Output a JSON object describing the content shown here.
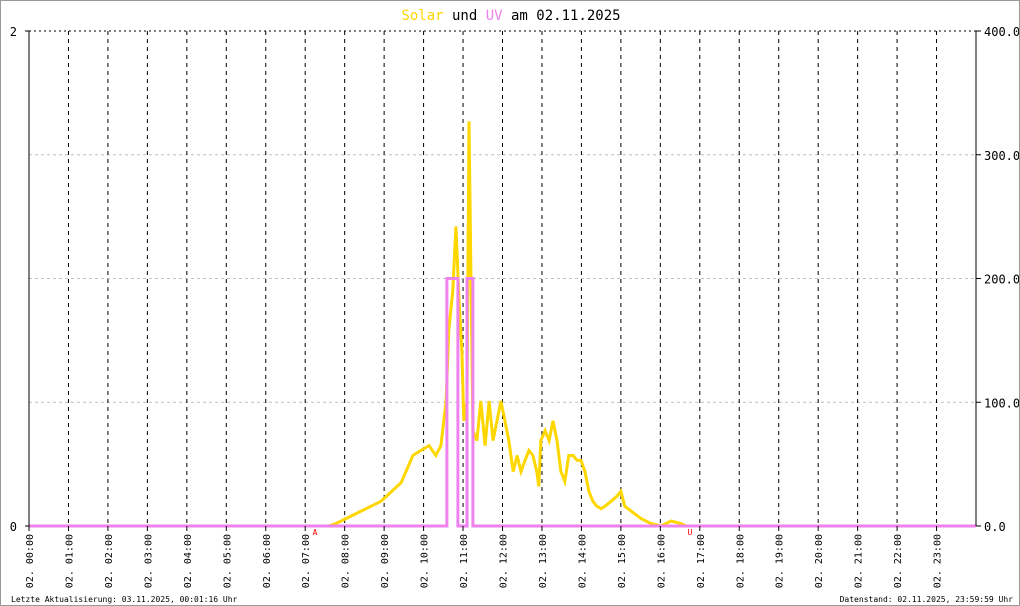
{
  "chart_data": {
    "type": "line",
    "title": {
      "part1": "Solar",
      "part2": " und ",
      "part3": "UV",
      "part4": " am 02.11.2025"
    },
    "x_unit": "hours",
    "xlim": [
      0,
      24
    ],
    "x_tick_labels": [
      "02. 00:00",
      "02. 01:00",
      "02. 02:00",
      "02. 03:00",
      "02. 04:00",
      "02. 05:00",
      "02. 06:00",
      "02. 07:00",
      "02. 08:00",
      "02. 09:00",
      "02. 10:00",
      "02. 11:00",
      "02. 12:00",
      "02. 13:00",
      "02. 14:00",
      "02. 15:00",
      "02. 16:00",
      "02. 17:00",
      "02. 18:00",
      "02. 19:00",
      "02. 20:00",
      "02. 21:00",
      "02. 22:00",
      "02. 23:00"
    ],
    "left_axis": {
      "label": "UV",
      "ylim": [
        0,
        2
      ],
      "tick_labels": [
        "0",
        "2"
      ]
    },
    "right_axis": {
      "label": "Solar",
      "ylim": [
        0,
        400
      ],
      "tick_labels": [
        "0.0",
        "100.0",
        "200.0",
        "300.0",
        "400.0"
      ]
    },
    "grid": true,
    "markers": [
      {
        "label": "A",
        "x": 7.25
      },
      {
        "label": "U",
        "x": 16.75
      }
    ],
    "series": [
      {
        "name": "Solar",
        "axis": "right",
        "color": "#FFD700",
        "points": [
          [
            0,
            0
          ],
          [
            7.6,
            0
          ],
          [
            7.78,
            2
          ],
          [
            8.16,
            8
          ],
          [
            8.92,
            20
          ],
          [
            9.43,
            35
          ],
          [
            9.73,
            57
          ],
          [
            9.93,
            61
          ],
          [
            10.14,
            65
          ],
          [
            10.31,
            57
          ],
          [
            10.44,
            65
          ],
          [
            10.57,
            101
          ],
          [
            10.64,
            158
          ],
          [
            10.74,
            190
          ],
          [
            10.82,
            242
          ],
          [
            10.9,
            182
          ],
          [
            10.97,
            141
          ],
          [
            11.02,
            85
          ],
          [
            11.1,
            101
          ],
          [
            11.15,
            327
          ],
          [
            11.2,
            206
          ],
          [
            11.25,
            77
          ],
          [
            11.35,
            69
          ],
          [
            11.45,
            101
          ],
          [
            11.56,
            65
          ],
          [
            11.66,
            101
          ],
          [
            11.76,
            69
          ],
          [
            11.86,
            85
          ],
          [
            11.96,
            101
          ],
          [
            12.06,
            85
          ],
          [
            12.16,
            69
          ],
          [
            12.27,
            44
          ],
          [
            12.37,
            57
          ],
          [
            12.47,
            44
          ],
          [
            12.57,
            53
          ],
          [
            12.67,
            61
          ],
          [
            12.77,
            57
          ],
          [
            12.87,
            44
          ],
          [
            12.92,
            32
          ],
          [
            12.97,
            69
          ],
          [
            13.08,
            77
          ],
          [
            13.18,
            69
          ],
          [
            13.28,
            85
          ],
          [
            13.38,
            69
          ],
          [
            13.48,
            44
          ],
          [
            13.58,
            36
          ],
          [
            13.68,
            57
          ],
          [
            13.79,
            57
          ],
          [
            13.89,
            53
          ],
          [
            13.99,
            53
          ],
          [
            14.09,
            44
          ],
          [
            14.19,
            28
          ],
          [
            14.29,
            20
          ],
          [
            14.39,
            16
          ],
          [
            14.5,
            14
          ],
          [
            14.6,
            16
          ],
          [
            14.75,
            20
          ],
          [
            14.9,
            24
          ],
          [
            15.0,
            28
          ],
          [
            15.1,
            16
          ],
          [
            15.26,
            12
          ],
          [
            15.51,
            6
          ],
          [
            15.76,
            2
          ],
          [
            16.02,
            0
          ],
          [
            16.27,
            4
          ],
          [
            16.52,
            2
          ],
          [
            16.65,
            0
          ],
          [
            24,
            0
          ]
        ]
      },
      {
        "name": "UV",
        "axis": "left",
        "color": "#EE82EE",
        "points": [
          [
            0,
            0
          ],
          [
            10.59,
            0
          ],
          [
            10.59,
            1
          ],
          [
            10.87,
            1
          ],
          [
            10.87,
            0
          ],
          [
            11.1,
            0
          ],
          [
            11.1,
            1
          ],
          [
            11.25,
            1
          ],
          [
            11.25,
            0
          ],
          [
            24,
            0
          ]
        ]
      }
    ]
  },
  "footer": {
    "left": "Letzte Aktualisierung: 03.11.2025, 00:01:16 Uhr",
    "right": "Datenstand: 02.11.2025, 23:59:59 Uhr"
  }
}
